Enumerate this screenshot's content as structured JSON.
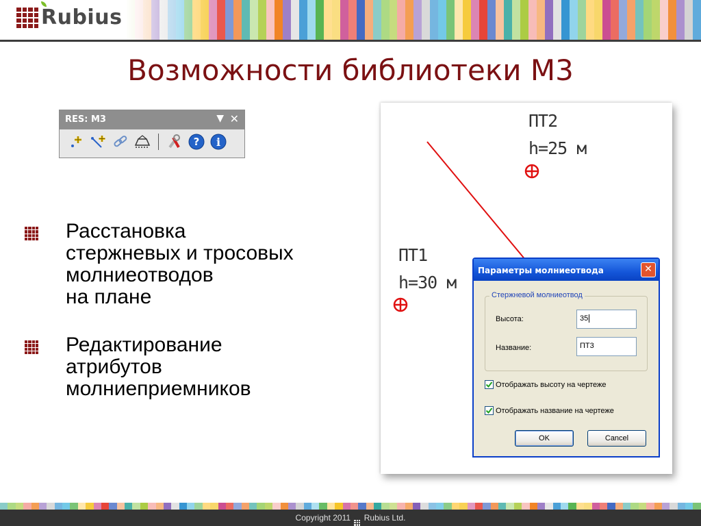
{
  "header": {
    "brand": "Rubius"
  },
  "slide": {
    "title": "Возможности библиотеки М3"
  },
  "toolbar": {
    "title": "RES: M3",
    "dropdown_icon": "dropdown-arrow-icon",
    "close_icon": "close-icon",
    "buttons": [
      {
        "icon": "add-rod-icon"
      },
      {
        "icon": "add-cable-icon"
      },
      {
        "icon": "link-icon"
      },
      {
        "icon": "zone-icon"
      },
      {
        "icon": "settings-tools-icon"
      },
      {
        "icon": "help-icon"
      },
      {
        "icon": "info-icon"
      }
    ]
  },
  "bullets": [
    {
      "lines": [
        "Расстановка",
        "стержневых и тросовых",
        "молниеотводов",
        "на плане"
      ]
    },
    {
      "lines": [
        "Редактирование",
        "атрибутов",
        "молниеприемников"
      ]
    }
  ],
  "drawing": {
    "pt2_name": "ПТ2",
    "pt2_height": "h=25 м",
    "pt1_name": "ПТ1",
    "pt1_height": "h=30 м",
    "line_color": "#e01010",
    "marker_color": "#e01010"
  },
  "dialog": {
    "title": "Параметры молниеотвода",
    "group_label": "Стержневой молниеотвод",
    "height_label": "Высота:",
    "height_value": "35",
    "name_label": "Название:",
    "name_value": "ПТ3",
    "show_height_label": "Отображать высоту на чертеже",
    "show_height_checked": true,
    "show_name_label": "Отображать название на чертеже",
    "show_name_checked": true,
    "ok_label": "OK",
    "cancel_label": "Cancel"
  },
  "footer": {
    "copyright_prefix": "Copyright 2011",
    "company": "Rubius Ltd."
  },
  "colors": {
    "title": "#7b1113",
    "brand_mark": "#8b1a1a",
    "footer_bg": "#333333"
  }
}
